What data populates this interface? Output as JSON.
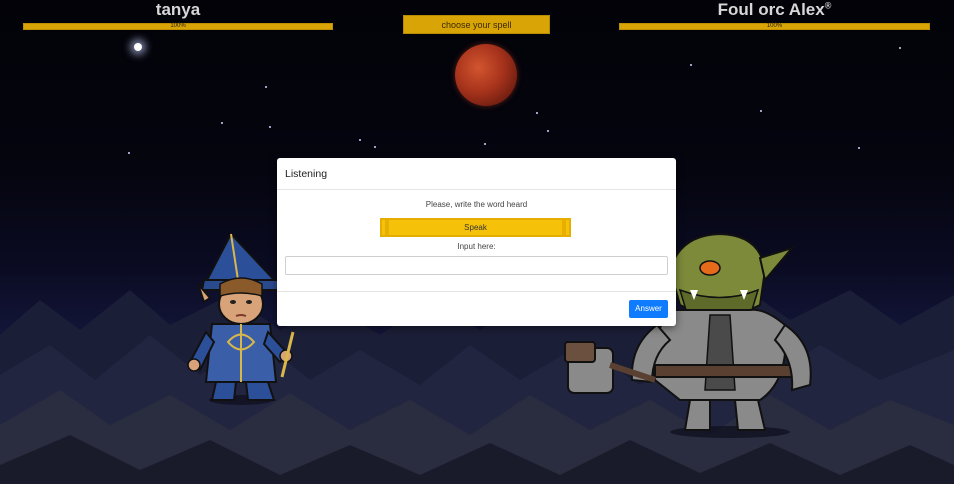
{
  "player": {
    "name": "tanya",
    "hp_text": "100%",
    "hp_fraction": 1.0
  },
  "enemy": {
    "name": "Foul orc Alex",
    "badge": "®",
    "hp_text": "100%",
    "hp_fraction": 1.0
  },
  "spell_button": {
    "label": "choose your spell"
  },
  "modal": {
    "title": "Listening",
    "prompt": "Please, write the word heard",
    "speak_label": "Speak",
    "input_label": "Input here:",
    "input_value": "",
    "answer_label": "Answer"
  },
  "colors": {
    "accent": "#d9a406",
    "speak": "#f6c109",
    "primary": "#0f7bff",
    "moon": "#a7331c"
  }
}
